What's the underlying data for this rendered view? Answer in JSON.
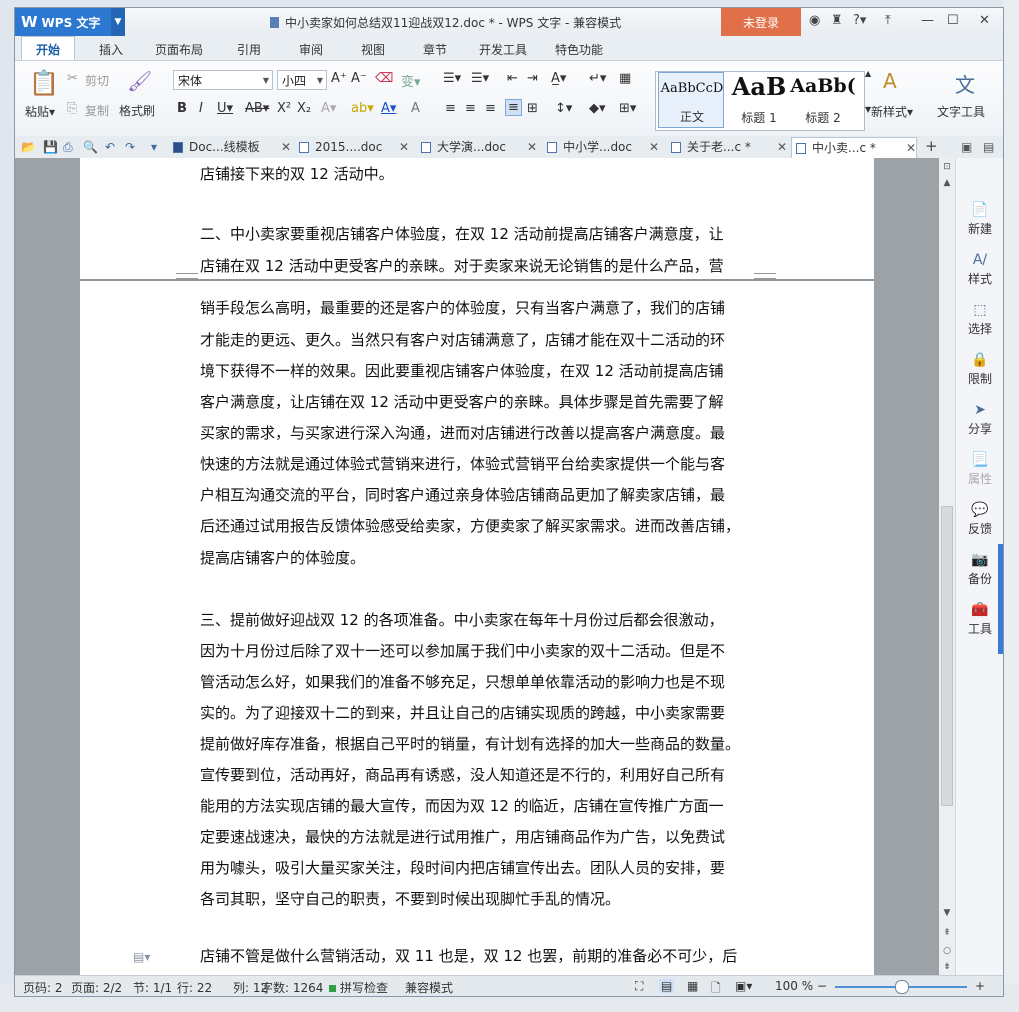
{
  "app": {
    "name": "WPS 文字",
    "title": "中小卖家如何总结双11迎战双12.doc * - WPS 文字 - 兼容模式",
    "login": "未登录",
    "help": "?"
  },
  "tabs": [
    "开始",
    "插入",
    "页面布局",
    "引用",
    "审阅",
    "视图",
    "章节",
    "开发工具",
    "特色功能"
  ],
  "ribbon": {
    "paste": "粘贴",
    "cut": "剪切",
    "copy": "复制",
    "format_painter": "格式刷",
    "font": "宋体",
    "size": "小四",
    "styles": [
      {
        "preview": "AaBbCcD",
        "name": "正文"
      },
      {
        "preview": "AaB",
        "name": "标题 1"
      },
      {
        "preview": "AaBb(",
        "name": "标题 2"
      }
    ],
    "new_style": "新样式",
    "text_tools": "文字工具"
  },
  "doc_tabs": [
    "Doc...线模板",
    "2015....doc",
    "大学演...doc",
    "中小学...doc",
    "关于老...c *",
    "中小卖...c *"
  ],
  "document": {
    "lines": [
      "店铺接下来的双 12 活动中。",
      "",
      "二、中小卖家要重视店铺客户体验度，在双 12 活动前提高店铺客户满意度，让",
      "店铺在双 12 活动中更受客户的亲睐。对于卖家来说无论销售的是什么产品，营",
      "销手段怎么高明，最重要的还是客户的体验度，只有当客户满意了，我们的店铺",
      "才能走的更远、更久。当然只有客户对店铺满意了，店铺才能在双十二活动的环",
      "境下获得不一样的效果。因此要重视店铺客户体验度，在双 12 活动前提高店铺",
      "客户满意度，让店铺在双 12 活动中更受客户的亲睐。具体步骤是首先需要了解",
      "买家的需求，与买家进行深入沟通，进而对店铺进行改善以提高客户满意度。最",
      "快速的方法就是通过体验式营销来进行，体验式营销平台给卖家提供一个能与客",
      "户相互沟通交流的平台，同时客户通过亲身体验店铺商品更加了解卖家店铺，最",
      "后还通过试用报告反馈体验感受给卖家，方便卖家了解买家需求。进而改善店铺，",
      "提高店铺客户的体验度。",
      "",
      "三、提前做好迎战双 12 的各项准备。中小卖家在每年十月份过后都会很激动，",
      "因为十月份过后除了双十一还可以参加属于我们中小卖家的双十二活动。但是不",
      "管活动怎么好，如果我们的准备不够充足，只想单单依靠活动的影响力也是不现",
      "实的。为了迎接双十二的到来，并且让自己的店铺实现质的跨越，中小卖家需要",
      "提前做好库存准备，根据自己平时的销量，有计划有选择的加大一些商品的数量。",
      "宣传要到位，活动再好，商品再有诱惑，没人知道还是不行的，利用好自己所有",
      "能用的方法实现店铺的最大宣传，而因为双 12 的临近，店铺在宣传推广方面一",
      "定要速战速决，最快的方法就是进行试用推广，用店铺商品作为广告，以免费试",
      "用为噱头，吸引大量买家关注，段时间内把店铺宣传出去。团队人员的安排，要",
      "各司其职，坚守自己的职责，不要到时候出现脚忙手乱的情况。",
      "",
      "店铺不管是做什么营销活动，双 11 也是，双 12 也罢，前期的准备必不可少，后"
    ]
  },
  "right_panel": [
    "新建",
    "样式",
    "选择",
    "限制",
    "分享",
    "属性",
    "反馈",
    "备份",
    "工具"
  ],
  "status": {
    "page_num": "页码: 2",
    "page": "页面: 2/2",
    "section": "节: 1/1",
    "row": "行: 22",
    "col": "列: 12",
    "words": "字数: 1264",
    "spell": "拼写检查",
    "compat": "兼容模式",
    "zoom": "100 %"
  }
}
